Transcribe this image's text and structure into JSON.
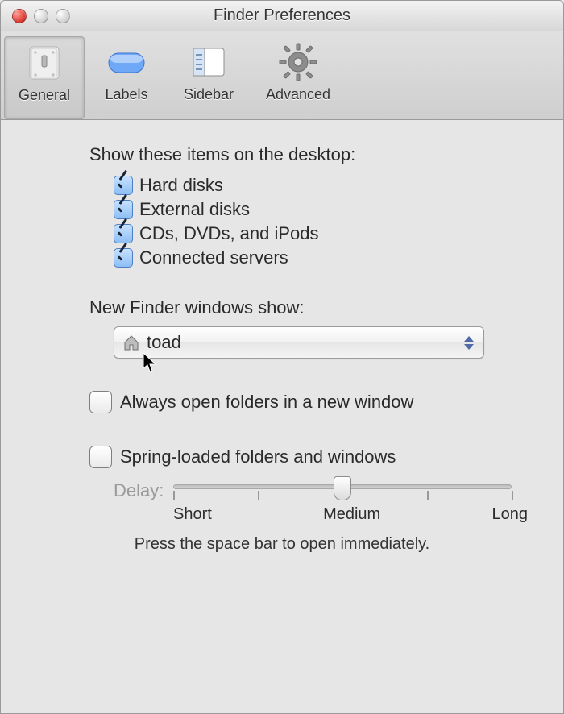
{
  "window": {
    "title": "Finder Preferences"
  },
  "toolbar": {
    "items": [
      {
        "label": "General",
        "selected": true,
        "icon": "switch-icon"
      },
      {
        "label": "Labels",
        "selected": false,
        "icon": "label-pill-icon"
      },
      {
        "label": "Sidebar",
        "selected": false,
        "icon": "sidebar-icon"
      },
      {
        "label": "Advanced",
        "selected": false,
        "icon": "gear-icon"
      }
    ]
  },
  "desktop_section": {
    "heading": "Show these items on the desktop:",
    "items": [
      {
        "label": "Hard disks",
        "checked": true
      },
      {
        "label": "External disks",
        "checked": true
      },
      {
        "label": "CDs, DVDs, and iPods",
        "checked": true
      },
      {
        "label": "Connected servers",
        "checked": true
      }
    ]
  },
  "new_finder": {
    "heading": "New Finder windows show:",
    "value": "toad",
    "icon": "home-icon"
  },
  "always_open": {
    "label": "Always open folders in a new window",
    "checked": false
  },
  "spring_loaded": {
    "label": "Spring-loaded folders and windows",
    "checked": false,
    "delay_label": "Delay:",
    "ticks": [
      "Short",
      "Medium",
      "Long"
    ],
    "value_percent": 50,
    "hint": "Press the space bar to open immediately."
  }
}
